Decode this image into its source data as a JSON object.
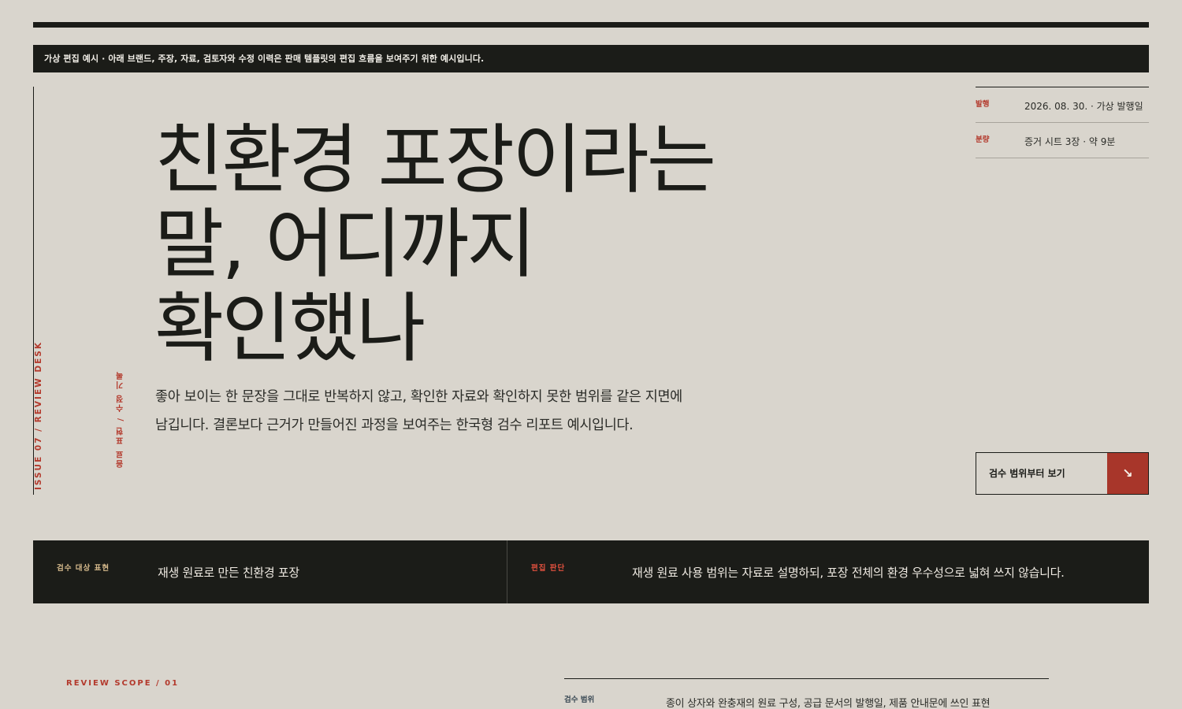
{
  "notice": "가상 편집 예시 · 아래 브랜드, 주장, 자료, 검토자와 수정 이력은 판매 템플릿의 편집 흐름을 보여주기 위한 예시입니다.",
  "side": {
    "issue_label": "ISSUE 07 / REVIEW DESK",
    "inner_label": "음료 표현 / 수정 기록"
  },
  "meta": [
    {
      "label": "발행",
      "value": "2026. 08. 30. · 가상 발행일"
    },
    {
      "label": "분량",
      "value": "증거 시트 3장 · 약 9분"
    }
  ],
  "hero": {
    "title_lines": [
      "친환경 포장이라는",
      "말, 어디까지",
      "확인했나"
    ],
    "lede_lines": [
      "좋아 보이는 한 문장을 그대로 반복하지 않고, 확인한 자료와 확인하지 못한 범위를 같은 지면에",
      "남깁니다. 결론보다 근거가 만들어진 과정을 보여주는 한국형 검수 리포트 예시입니다."
    ]
  },
  "cta": {
    "label": "검수 범위부터 보기",
    "icon": "arrow-down-right-icon",
    "arrow": "↘"
  },
  "verdict": {
    "target_label": "검수 대상 표현",
    "target_text": "재생 원료로 만든 친환경 포장",
    "judgment_label": "편집 판단",
    "judgment_text": "재생 원료 사용 범위는 자료로 설명하되, 포장 전체의 환경 우수성으로 넓혀 쓰지 않습니다."
  },
  "scope": {
    "kicker": "REVIEW SCOPE / 01",
    "label": "검수 범위",
    "text": "종이 상자와 완충재의 원료 구성, 공급 문서의 발행일, 제품 안내문에 쓰인 표현"
  },
  "colors": {
    "accent": "#b3392c",
    "ink": "#1b1c18",
    "paper": "#d9d5cd",
    "cta_fill": "#a8362a"
  }
}
